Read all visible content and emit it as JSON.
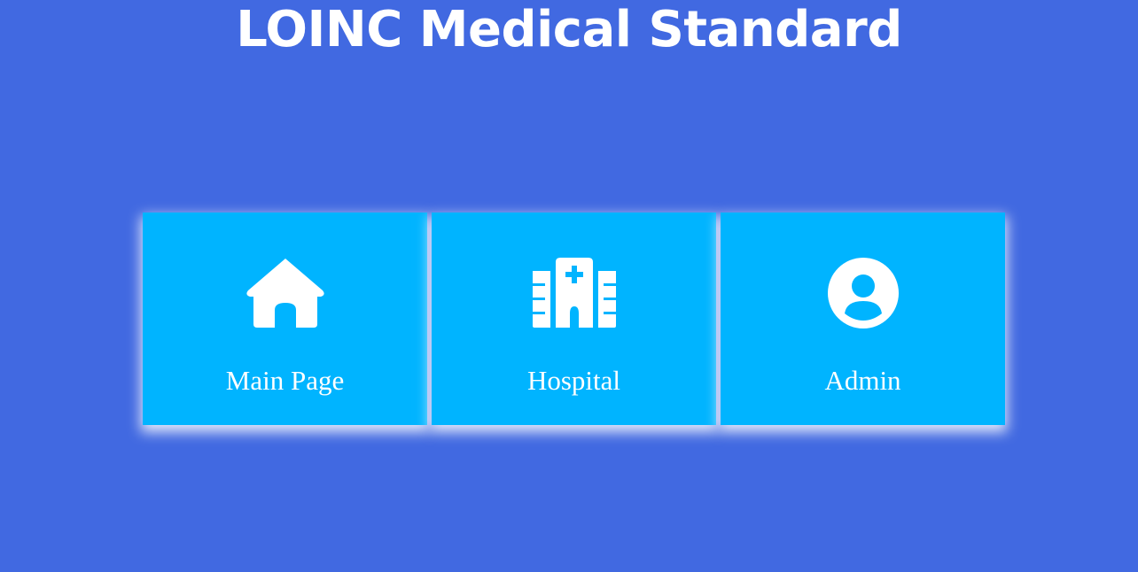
{
  "header": {
    "title": "LOINC Medical Standard"
  },
  "colors": {
    "background": "#4169e1",
    "card": "#00b4ff",
    "text": "#ffffff"
  },
  "cards": [
    {
      "label": "Main Page",
      "icon": "home-icon"
    },
    {
      "label": "Hospital",
      "icon": "hospital-icon"
    },
    {
      "label": "Admin",
      "icon": "user-circle-icon"
    }
  ]
}
